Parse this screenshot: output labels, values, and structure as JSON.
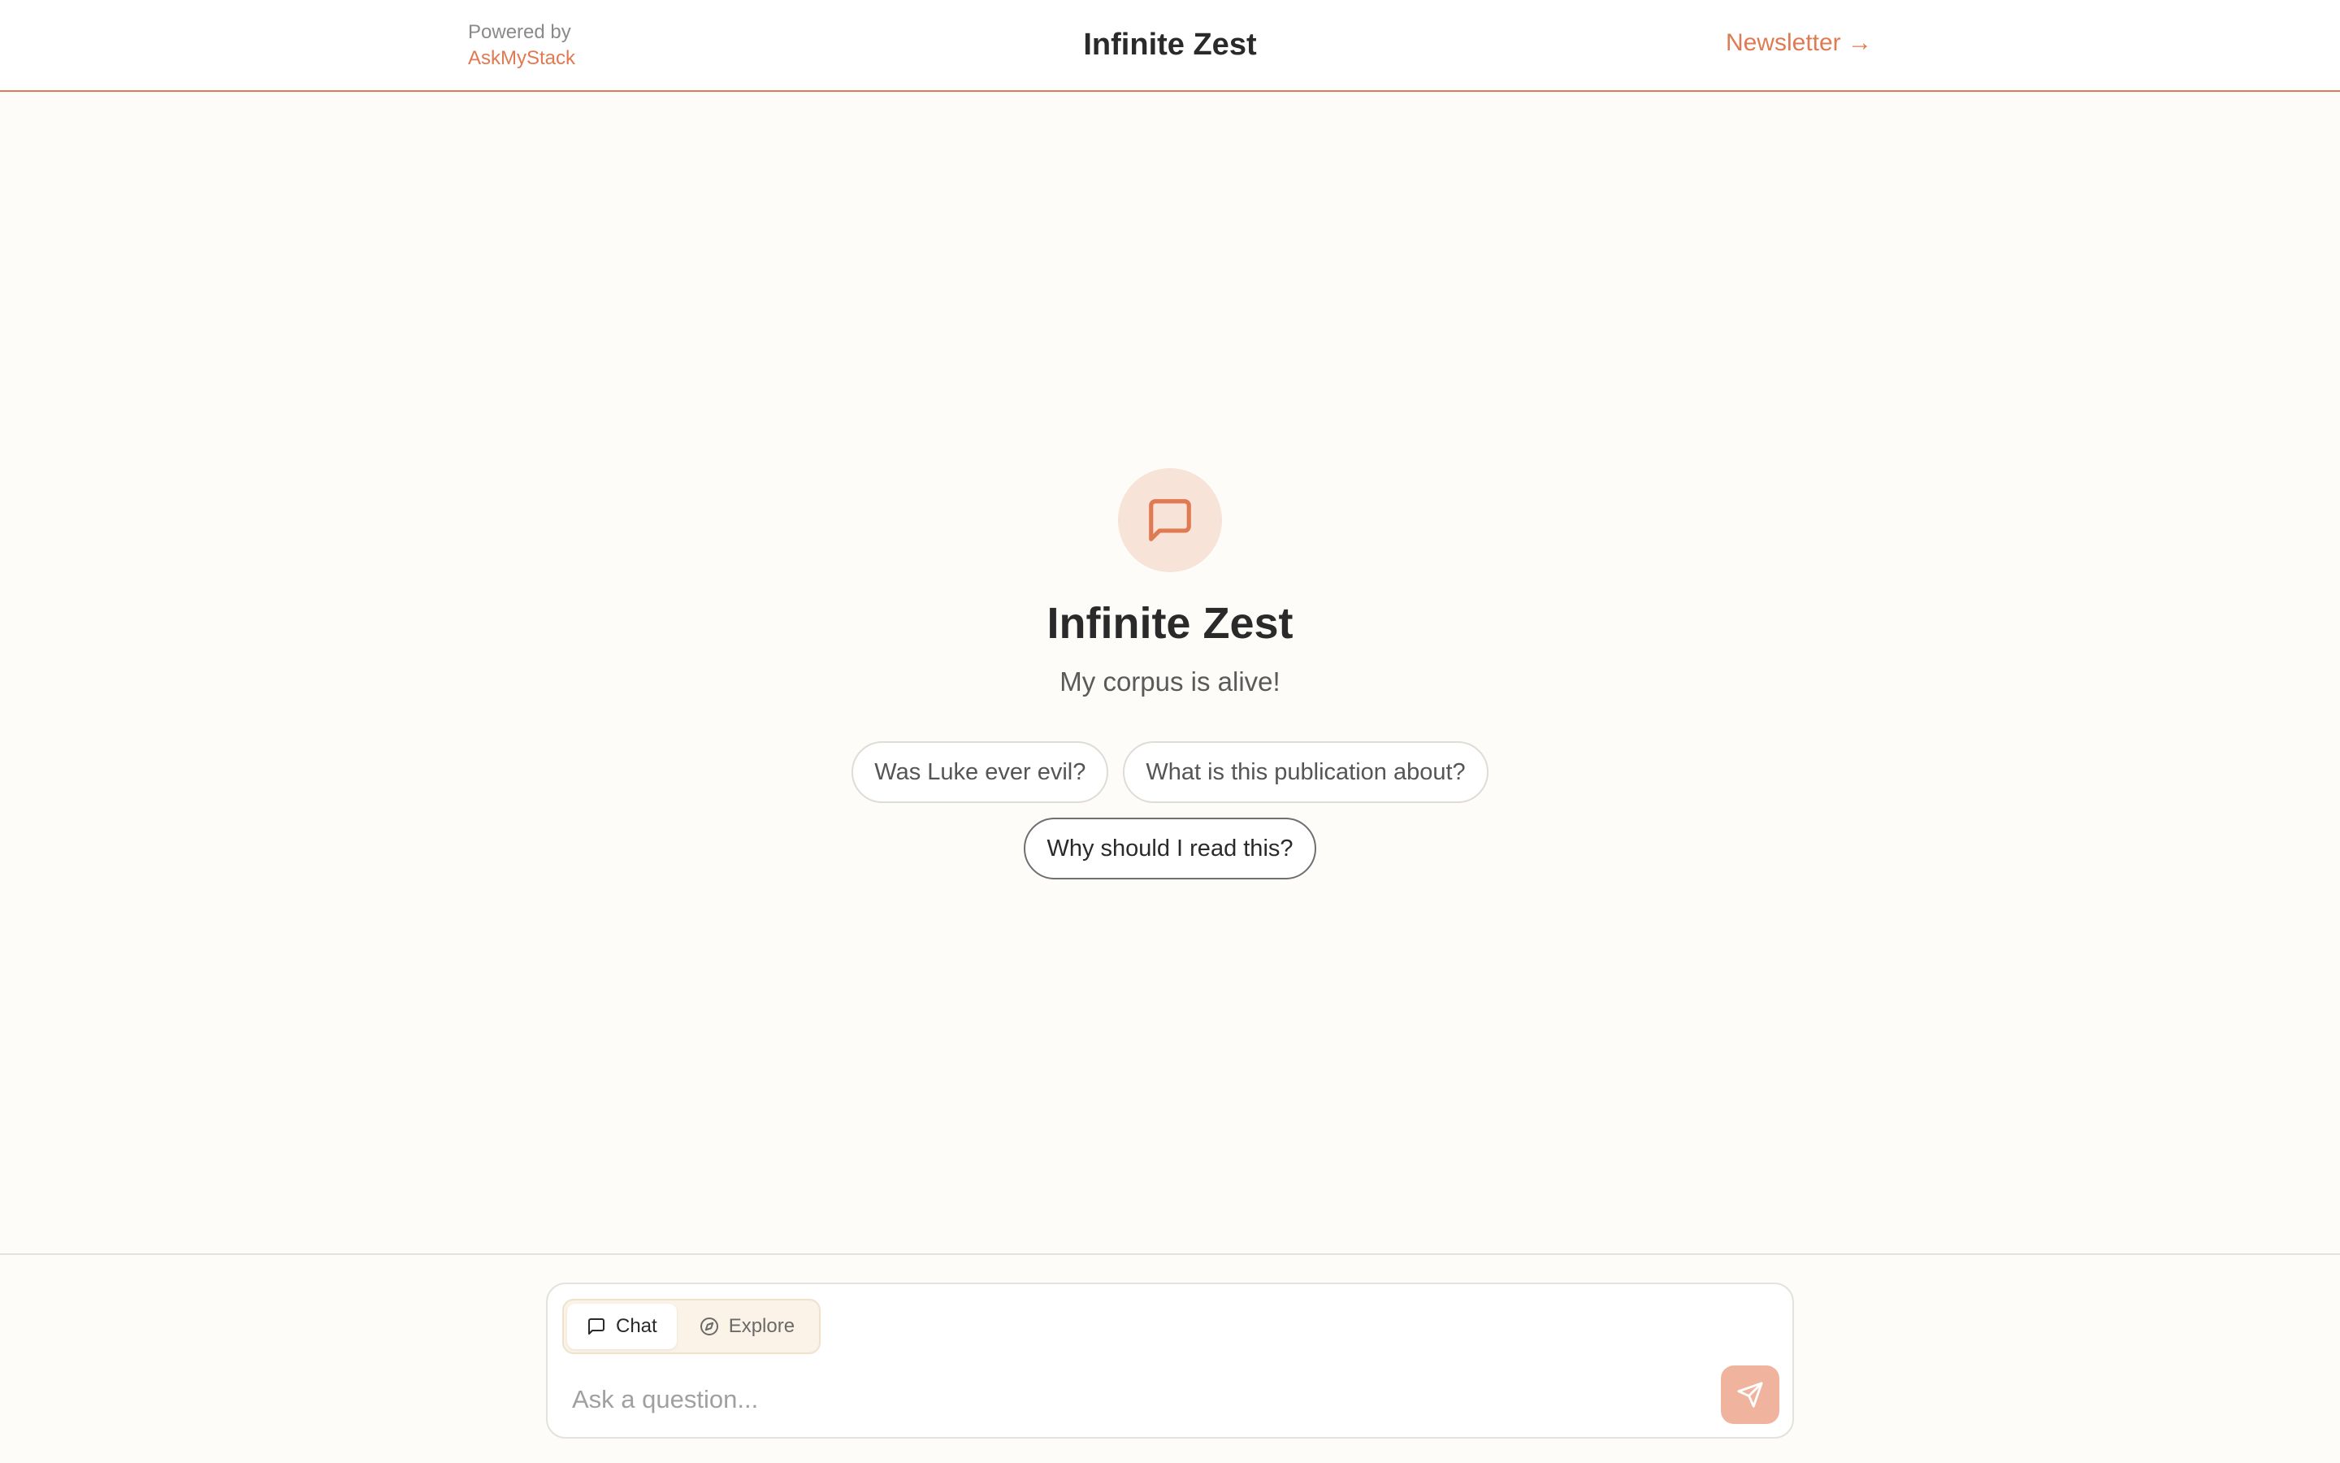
{
  "header": {
    "powered_label": "Powered by",
    "powered_brand": "AskMyStack",
    "title": "Infinite Zest",
    "newsletter_link": "Newsletter →"
  },
  "hero": {
    "icon": "message-square-icon",
    "title": "Infinite Zest",
    "subtitle": "My corpus is alive!",
    "suggestions": [
      "Was Luke ever evil?",
      "What is this publication about?",
      "Why should I read this?"
    ]
  },
  "composer": {
    "tabs": [
      {
        "label": "Chat",
        "icon": "message-square-icon",
        "active": true
      },
      {
        "label": "Explore",
        "icon": "compass-icon",
        "active": false
      }
    ],
    "placeholder": "Ask a question...",
    "send_icon": "send-icon"
  },
  "colors": {
    "accent": "#e07a52",
    "accent_soft": "#f7e3d8",
    "send_button": "#f0b49e",
    "background": "#fdfcf8"
  }
}
